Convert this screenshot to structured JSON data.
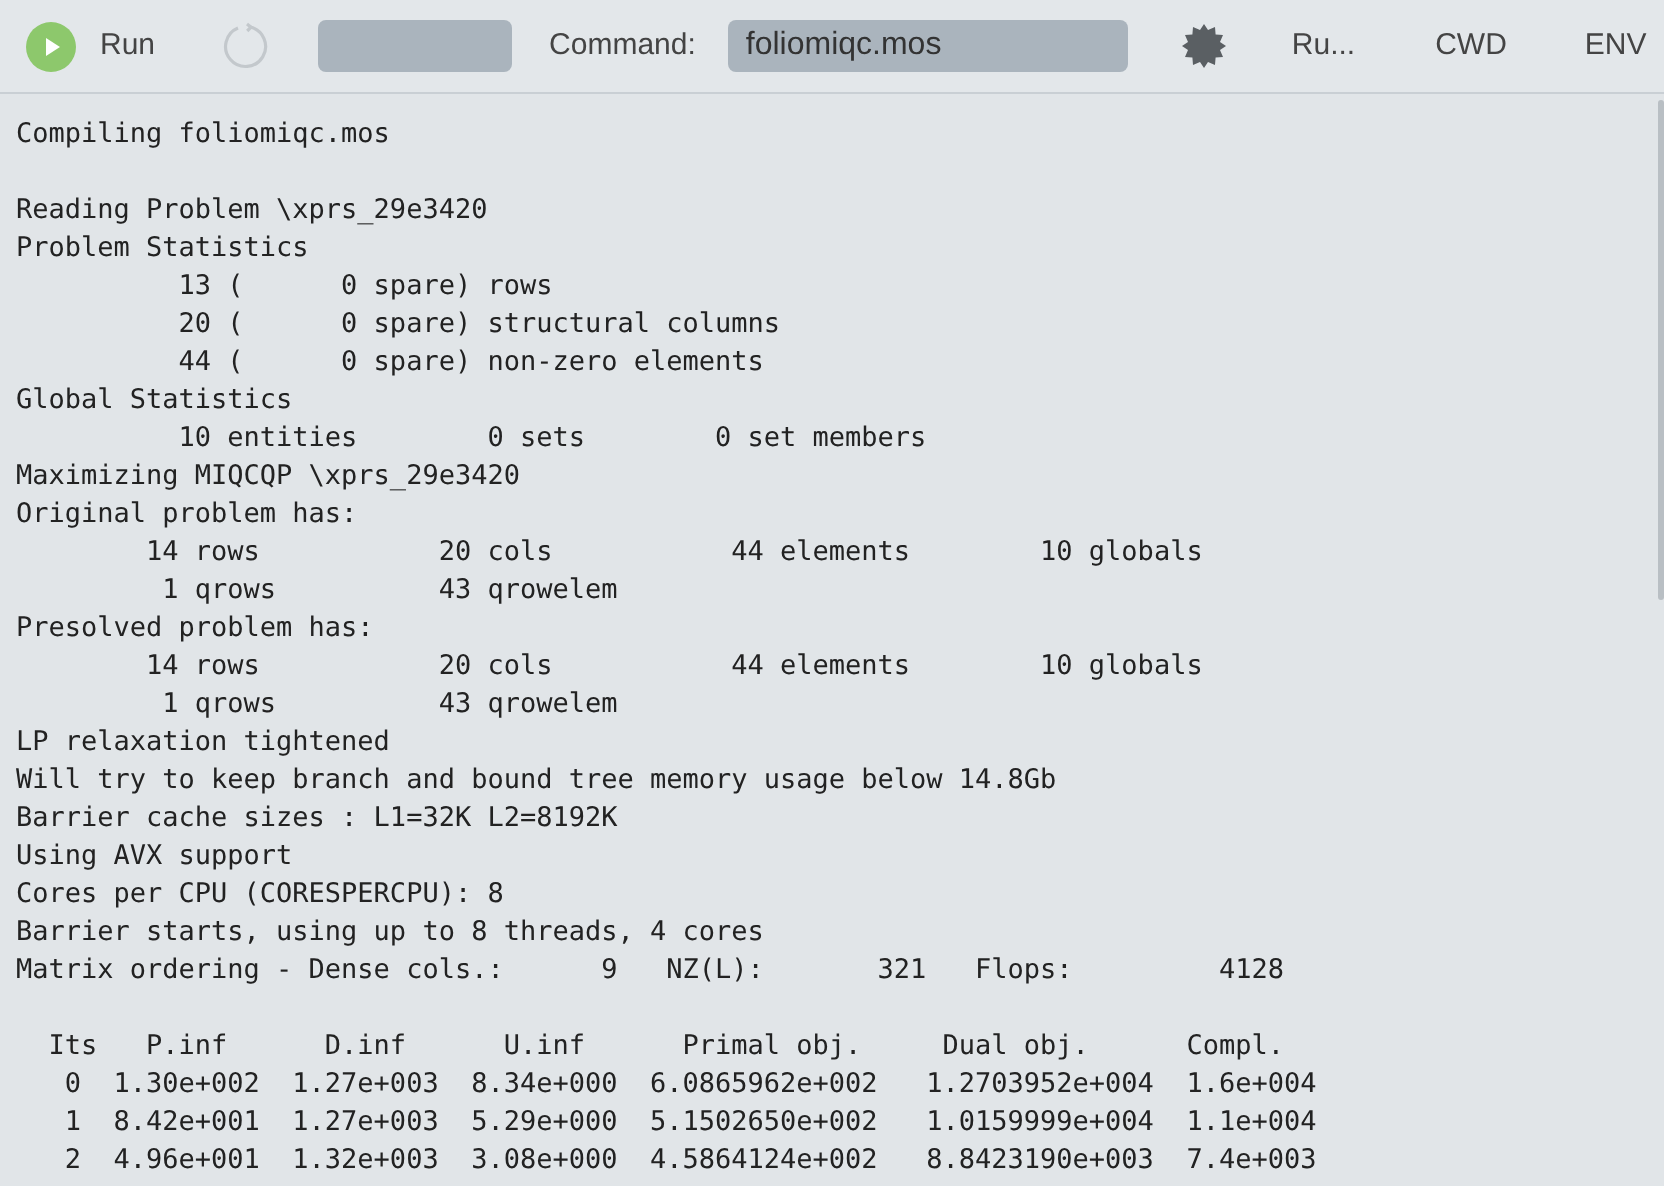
{
  "toolbar": {
    "run_label": "Run",
    "command_label": "Command:",
    "command_value": "foliomiqc.mos",
    "buttons": [
      "Ru...",
      "CWD",
      "ENV"
    ]
  },
  "output": [
    {
      "lines": [
        "Compiling foliomiqc.mos"
      ]
    },
    {
      "lines": [
        "Reading Problem \\xprs_29e3420",
        "Problem Statistics",
        "          13 (      0 spare) rows",
        "          20 (      0 spare) structural columns",
        "          44 (      0 spare) non-zero elements",
        "Global Statistics",
        "          10 entities        0 sets        0 set members",
        "Maximizing MIQCQP \\xprs_29e3420",
        "Original problem has:",
        "        14 rows           20 cols           44 elements        10 globals",
        "         1 qrows          43 qrowelem",
        "Presolved problem has:",
        "        14 rows           20 cols           44 elements        10 globals",
        "         1 qrows          43 qrowelem",
        "LP relaxation tightened",
        "Will try to keep branch and bound tree memory usage below 14.8Gb",
        "Barrier cache sizes : L1=32K L2=8192K",
        "Using AVX support",
        "Cores per CPU (CORESPERCPU): 8",
        "Barrier starts, using up to 8 threads, 4 cores",
        "Matrix ordering - Dense cols.:      9   NZ(L):       321   Flops:         4128"
      ]
    },
    {
      "lines": [
        "  Its   P.inf      D.inf      U.inf      Primal obj.     Dual obj.      Compl.",
        "   0  1.30e+002  1.27e+003  8.34e+000  6.0865962e+002   1.2703952e+004  1.6e+004",
        "   1  8.42e+001  1.27e+003  5.29e+000  5.1502650e+002   1.0159999e+004  1.1e+004",
        "   2  4.96e+001  1.32e+003  3.08e+000  4.5864124e+002   8.8423190e+003  7.4e+003"
      ]
    }
  ]
}
